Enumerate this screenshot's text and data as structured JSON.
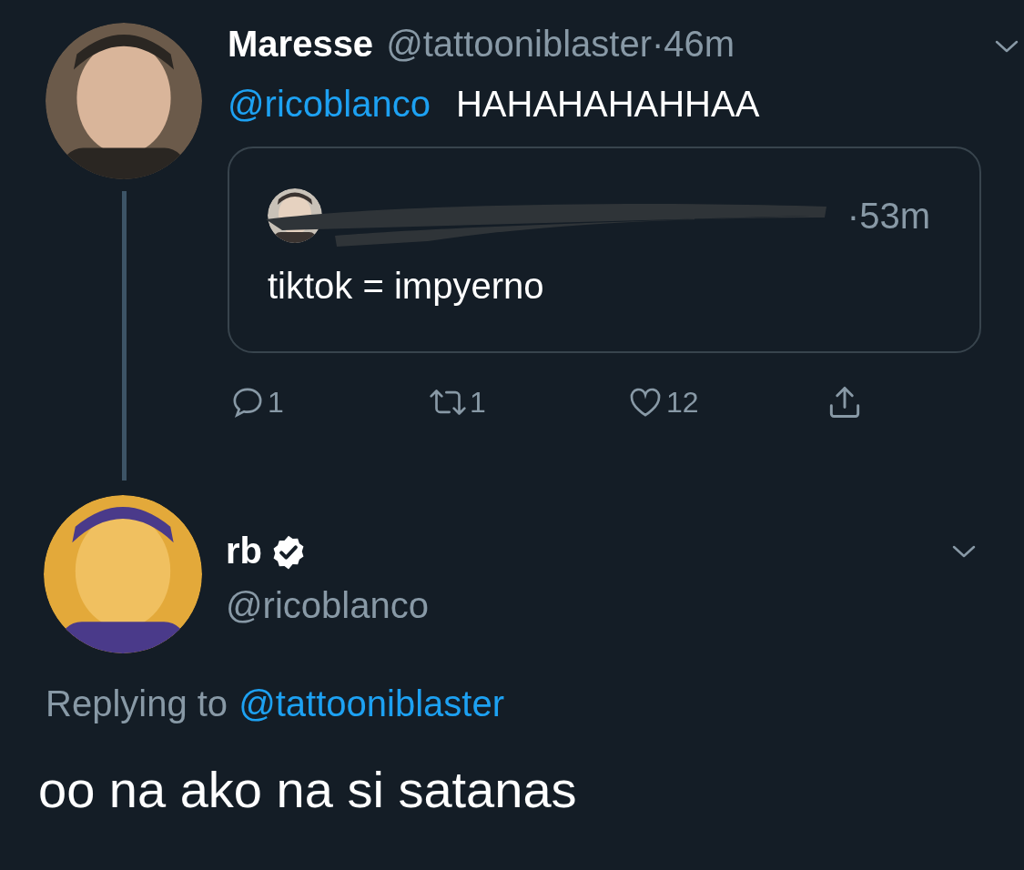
{
  "thread_tweet": {
    "name": "Maresse",
    "handle": "@tattooniblaster",
    "time": "·46m",
    "mention": "@ricoblanco",
    "text": "HAHAHAHAHHAA",
    "quote": {
      "time": "·53m",
      "text": "tiktok = impyerno"
    },
    "actions": [
      {
        "kind": "reply",
        "count": "1"
      },
      {
        "kind": "retweet",
        "count": "1"
      },
      {
        "kind": "like",
        "count": "12"
      },
      {
        "kind": "share"
      }
    ]
  },
  "main_tweet": {
    "name": "rb",
    "verified": true,
    "handle": "@ricoblanco",
    "replying_label": "Replying to",
    "replying_to": "@tattooniblaster",
    "text": "oo na ako na si satanas"
  }
}
